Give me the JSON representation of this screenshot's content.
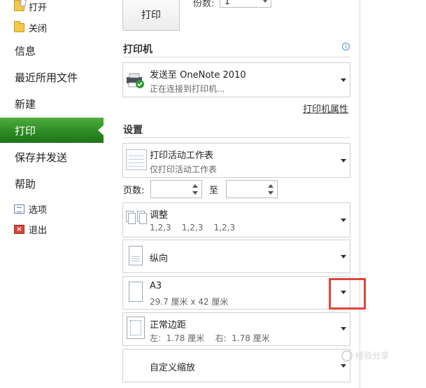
{
  "sidebar": {
    "small_top": [
      {
        "label": "打开",
        "icon": "open-folder-icon"
      },
      {
        "label": "关闭",
        "icon": "close-folder-icon"
      }
    ],
    "main_items": [
      {
        "label": "信息"
      },
      {
        "label": "最近所用文件"
      },
      {
        "label": "新建"
      },
      {
        "label": "打印",
        "active": true
      },
      {
        "label": "保存并发送"
      },
      {
        "label": "帮助"
      }
    ],
    "small_bottom": [
      {
        "label": "选项",
        "icon": "options-icon"
      },
      {
        "label": "退出",
        "icon": "exit-icon"
      }
    ],
    "active_color": "#2d8b24"
  },
  "print": {
    "button_label": "打印",
    "copies_label": "份数:",
    "copies_value": "1"
  },
  "printer": {
    "section_title": "打印机",
    "name": "发送至 OneNote 2010",
    "status": "正在连接到打印机...",
    "properties_link": "打印机属性"
  },
  "settings": {
    "section_title": "设置",
    "print_what": {
      "title": "打印活动工作表",
      "subtitle": "仅打印活动工作表"
    },
    "pages_label": "页数:",
    "pages_to_label": "至",
    "pages_from": "",
    "pages_to": "",
    "collate": {
      "title": "调整",
      "subtitle": "1,2,3    1,2,3    1,2,3"
    },
    "orientation": {
      "title": "纵向"
    },
    "paper": {
      "title": "A3",
      "subtitle": "29.7 厘米 x 42 厘米"
    },
    "margins": {
      "title": "正常边距",
      "subtitle": "左:  1.78 厘米    右:  1.78 厘米"
    },
    "scaling": {
      "title": "自定义缩放"
    }
  },
  "highlight_color": "#e0453a",
  "watermark": "经验分享"
}
